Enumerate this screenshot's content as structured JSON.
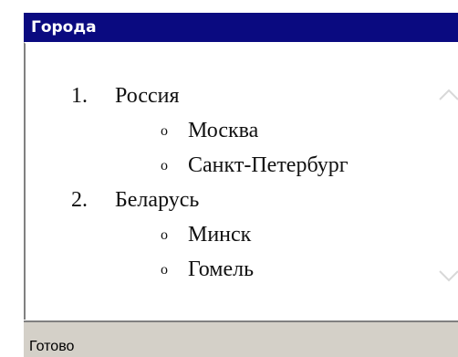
{
  "window": {
    "title": "Города"
  },
  "list": {
    "countries": [
      {
        "number": "1.",
        "name": "Россия",
        "cities": [
          {
            "bullet": "o",
            "name": "Москва"
          },
          {
            "bullet": "o",
            "name": "Санкт-Петербург"
          }
        ]
      },
      {
        "number": "2.",
        "name": "Беларусь",
        "cities": [
          {
            "bullet": "o",
            "name": "Минск"
          },
          {
            "bullet": "o",
            "name": "Гомель"
          }
        ]
      }
    ]
  },
  "statusbar": {
    "text": "Готово"
  },
  "icons": {
    "scroll_up": "chevron-up-icon",
    "scroll_down": "chevron-down-icon"
  },
  "colors": {
    "titlebar": "#0a0a80",
    "title_text": "#ffffff",
    "frame": "#d4d0c8",
    "content_bg": "#ffffff",
    "chevron": "#d8d8d8"
  }
}
